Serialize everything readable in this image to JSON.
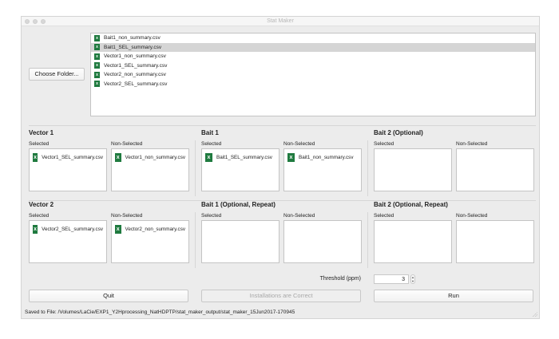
{
  "window": {
    "title": "Stat Maker"
  },
  "choose_folder_label": "Choose Folder...",
  "files": [
    {
      "name": "Bait1_non_summary.csv",
      "selected": false
    },
    {
      "name": "Bait1_SEL_summary.csv",
      "selected": true
    },
    {
      "name": "Vector1_non_summary.csv",
      "selected": false
    },
    {
      "name": "Vector1_SEL_summary.csv",
      "selected": false
    },
    {
      "name": "Vector2_non_summary.csv",
      "selected": false
    },
    {
      "name": "Vector2_SEL_summary.csv",
      "selected": false
    }
  ],
  "labels": {
    "selected": "Selected",
    "non_selected": "Non-Selected"
  },
  "groups": {
    "vector1": {
      "title": "Vector 1",
      "selected": "Vector1_SEL_summary.csv",
      "non_selected": "Vector1_non_summary.csv"
    },
    "bait1": {
      "title": "Bait 1",
      "selected": "Bait1_SEL_summary.csv",
      "non_selected": "Bait1_non_summary.csv"
    },
    "bait2": {
      "title": "Bait 2 (Optional)"
    },
    "vector2": {
      "title": "Vector 2",
      "selected": "Vector2_SEL_summary.csv",
      "non_selected": "Vector2_non_summary.csv"
    },
    "bait1r": {
      "title": "Bait 1 (Optional, Repeat)"
    },
    "bait2r": {
      "title": "Bait 2 (Optional, Repeat)"
    }
  },
  "threshold": {
    "label": "Threshold (ppm)",
    "value": "3"
  },
  "buttons": {
    "quit": "Quit",
    "install": "Installations are Correct",
    "run": "Run"
  },
  "status": "Saved to File: /Volumes/LaCie/EXP1_Y2Hprocessing_NatHDPTP/stat_maker_output/stat_maker_15Jun2017-170945"
}
